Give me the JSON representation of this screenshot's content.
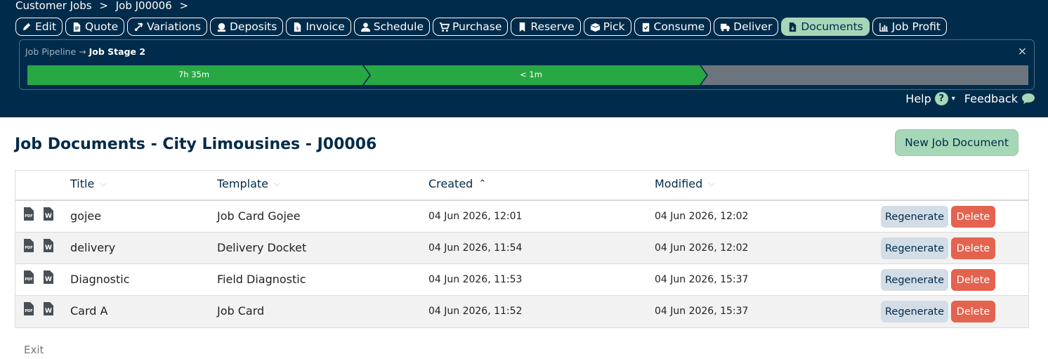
{
  "breadcrumb": {
    "items": [
      "Customer Jobs",
      ">",
      "Job J00006",
      ">"
    ]
  },
  "tabs": [
    {
      "label": "Edit",
      "icon": "pencil-icon"
    },
    {
      "label": "Quote",
      "icon": "document-icon"
    },
    {
      "label": "Variations",
      "icon": "branch-icon"
    },
    {
      "label": "Deposits",
      "icon": "coin-icon"
    },
    {
      "label": "Invoice",
      "icon": "invoice-icon"
    },
    {
      "label": "Schedule",
      "icon": "user-icon"
    },
    {
      "label": "Purchase",
      "icon": "cart-icon"
    },
    {
      "label": "Reserve",
      "icon": "bookmark-icon"
    },
    {
      "label": "Pick",
      "icon": "box-icon"
    },
    {
      "label": "Consume",
      "icon": "clipboard-icon"
    },
    {
      "label": "Deliver",
      "icon": "truck-icon"
    },
    {
      "label": "Documents",
      "icon": "file-download-icon",
      "active": true
    },
    {
      "label": "Job Profit",
      "icon": "chart-icon"
    }
  ],
  "pipeline": {
    "crumb_root": "Job Pipeline",
    "arrow": "→",
    "crumb_current": "Job Stage 2",
    "close": "×",
    "stages": [
      {
        "label": "7h 35m",
        "status": "complete",
        "color": "#28a745"
      },
      {
        "label": "< 1m",
        "status": "complete",
        "color": "#28a745"
      },
      {
        "label": "",
        "status": "pending",
        "color": "#6c757d"
      }
    ]
  },
  "help": {
    "help_label": "Help",
    "help_glyph": "?",
    "caret": "▾",
    "feedback_label": "Feedback"
  },
  "page": {
    "title": "Job Documents - City Limousines - J00006",
    "new_button": "New Job Document",
    "exit_link": "Exit"
  },
  "table": {
    "columns": [
      {
        "label": "Title",
        "sort": "⌵",
        "active": false
      },
      {
        "label": "Template",
        "sort": "⌵",
        "active": false
      },
      {
        "label": "Created",
        "sort": "⌃",
        "active": true
      },
      {
        "label": "Modified",
        "sort": "⌵",
        "active": false
      }
    ],
    "rows": [
      {
        "title": "gojee",
        "template": "Job Card Gojee",
        "created": "04 Jun 2026, 12:01",
        "modified": "04 Jun 2026, 12:02"
      },
      {
        "title": "delivery",
        "template": "Delivery Docket",
        "created": "04 Jun 2026, 11:54",
        "modified": "04 Jun 2026, 12:02"
      },
      {
        "title": "Diagnostic",
        "template": "Field Diagnostic",
        "created": "04 Jun 2026, 11:53",
        "modified": "04 Jun 2026, 15:37"
      },
      {
        "title": "Card A",
        "template": "Job Card",
        "created": "04 Jun 2026, 11:52",
        "modified": "04 Jun 2026, 15:37"
      }
    ],
    "regenerate_label": "Regenerate",
    "delete_label": "Delete",
    "pdf_badge": "PDF",
    "word_badge": "W"
  },
  "colors": {
    "navy": "#012b4a",
    "accent_green": "#a6d8b8",
    "stage_green": "#28a745",
    "stage_gray": "#6c757d",
    "delete_red": "#e4634f",
    "regen_blue": "#d3dde6"
  }
}
